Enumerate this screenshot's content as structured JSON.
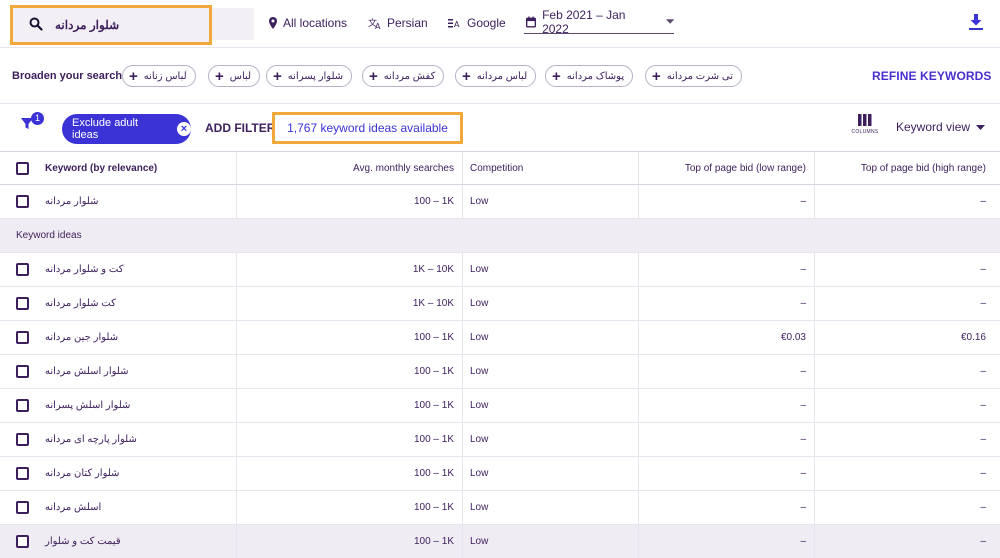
{
  "search": {
    "query": "شلوار مردانه",
    "icon": "search-icon"
  },
  "toolbar": {
    "location": "All locations",
    "language": "Persian",
    "network": "Google",
    "date_range": "Feb 2021 – Jan 2022"
  },
  "broaden": {
    "label": "Broaden your search:",
    "chips": [
      "لباس زنانه",
      "لباس",
      "شلوار پسرانه",
      "کفش مردانه",
      "لباس مردانه",
      "پوشاک مردانه",
      "تی شرت مردانه"
    ],
    "refine_label": "REFINE KEYWORDS"
  },
  "filters": {
    "badge_count": "1",
    "exclude_chip": "Exclude adult ideas",
    "add_filter": "ADD FILTER",
    "ideas_available": "1,767 keyword ideas available",
    "columns_label": "COLUMNS",
    "view_label": "Keyword view"
  },
  "table": {
    "headers": {
      "keyword": "Keyword (by relevance)",
      "avg": "Avg. monthly searches",
      "competition": "Competition",
      "bid_low": "Top of page bid (low range)",
      "bid_high": "Top of page bid (high range)"
    },
    "provided": [
      {
        "keyword": "شلوار مردانه",
        "avg": "100 – 1K",
        "competition": "Low",
        "bid_low": "–",
        "bid_high": "–"
      }
    ],
    "group_label": "Keyword ideas",
    "ideas": [
      {
        "keyword": "کت و شلوار مردانه",
        "avg": "1K – 10K",
        "competition": "Low",
        "bid_low": "–",
        "bid_high": "–"
      },
      {
        "keyword": "کت شلوار مردانه",
        "avg": "1K – 10K",
        "competition": "Low",
        "bid_low": "–",
        "bid_high": "–"
      },
      {
        "keyword": "شلوار جین مردانه",
        "avg": "100 – 1K",
        "competition": "Low",
        "bid_low": "€0.03",
        "bid_high": "€0.16"
      },
      {
        "keyword": "شلوار اسلش مردانه",
        "avg": "100 – 1K",
        "competition": "Low",
        "bid_low": "–",
        "bid_high": "–"
      },
      {
        "keyword": "شلوار اسلش پسرانه",
        "avg": "100 – 1K",
        "competition": "Low",
        "bid_low": "–",
        "bid_high": "–"
      },
      {
        "keyword": "شلوار پارچه ای مردانه",
        "avg": "100 – 1K",
        "competition": "Low",
        "bid_low": "–",
        "bid_high": "–"
      },
      {
        "keyword": "شلوار کتان مردانه",
        "avg": "100 – 1K",
        "competition": "Low",
        "bid_low": "–",
        "bid_high": "–"
      },
      {
        "keyword": "اسلش مردانه",
        "avg": "100 – 1K",
        "competition": "Low",
        "bid_low": "–",
        "bid_high": "–"
      },
      {
        "keyword": "قیمت کت و شلوار",
        "avg": "100 – 1K",
        "competition": "Low",
        "bid_low": "–",
        "bid_high": "–"
      }
    ]
  },
  "colors": {
    "accent": "#3b33d6",
    "highlight": "#f2a93b",
    "text": "#3c1f5c",
    "refine": "#4a2fcf"
  }
}
